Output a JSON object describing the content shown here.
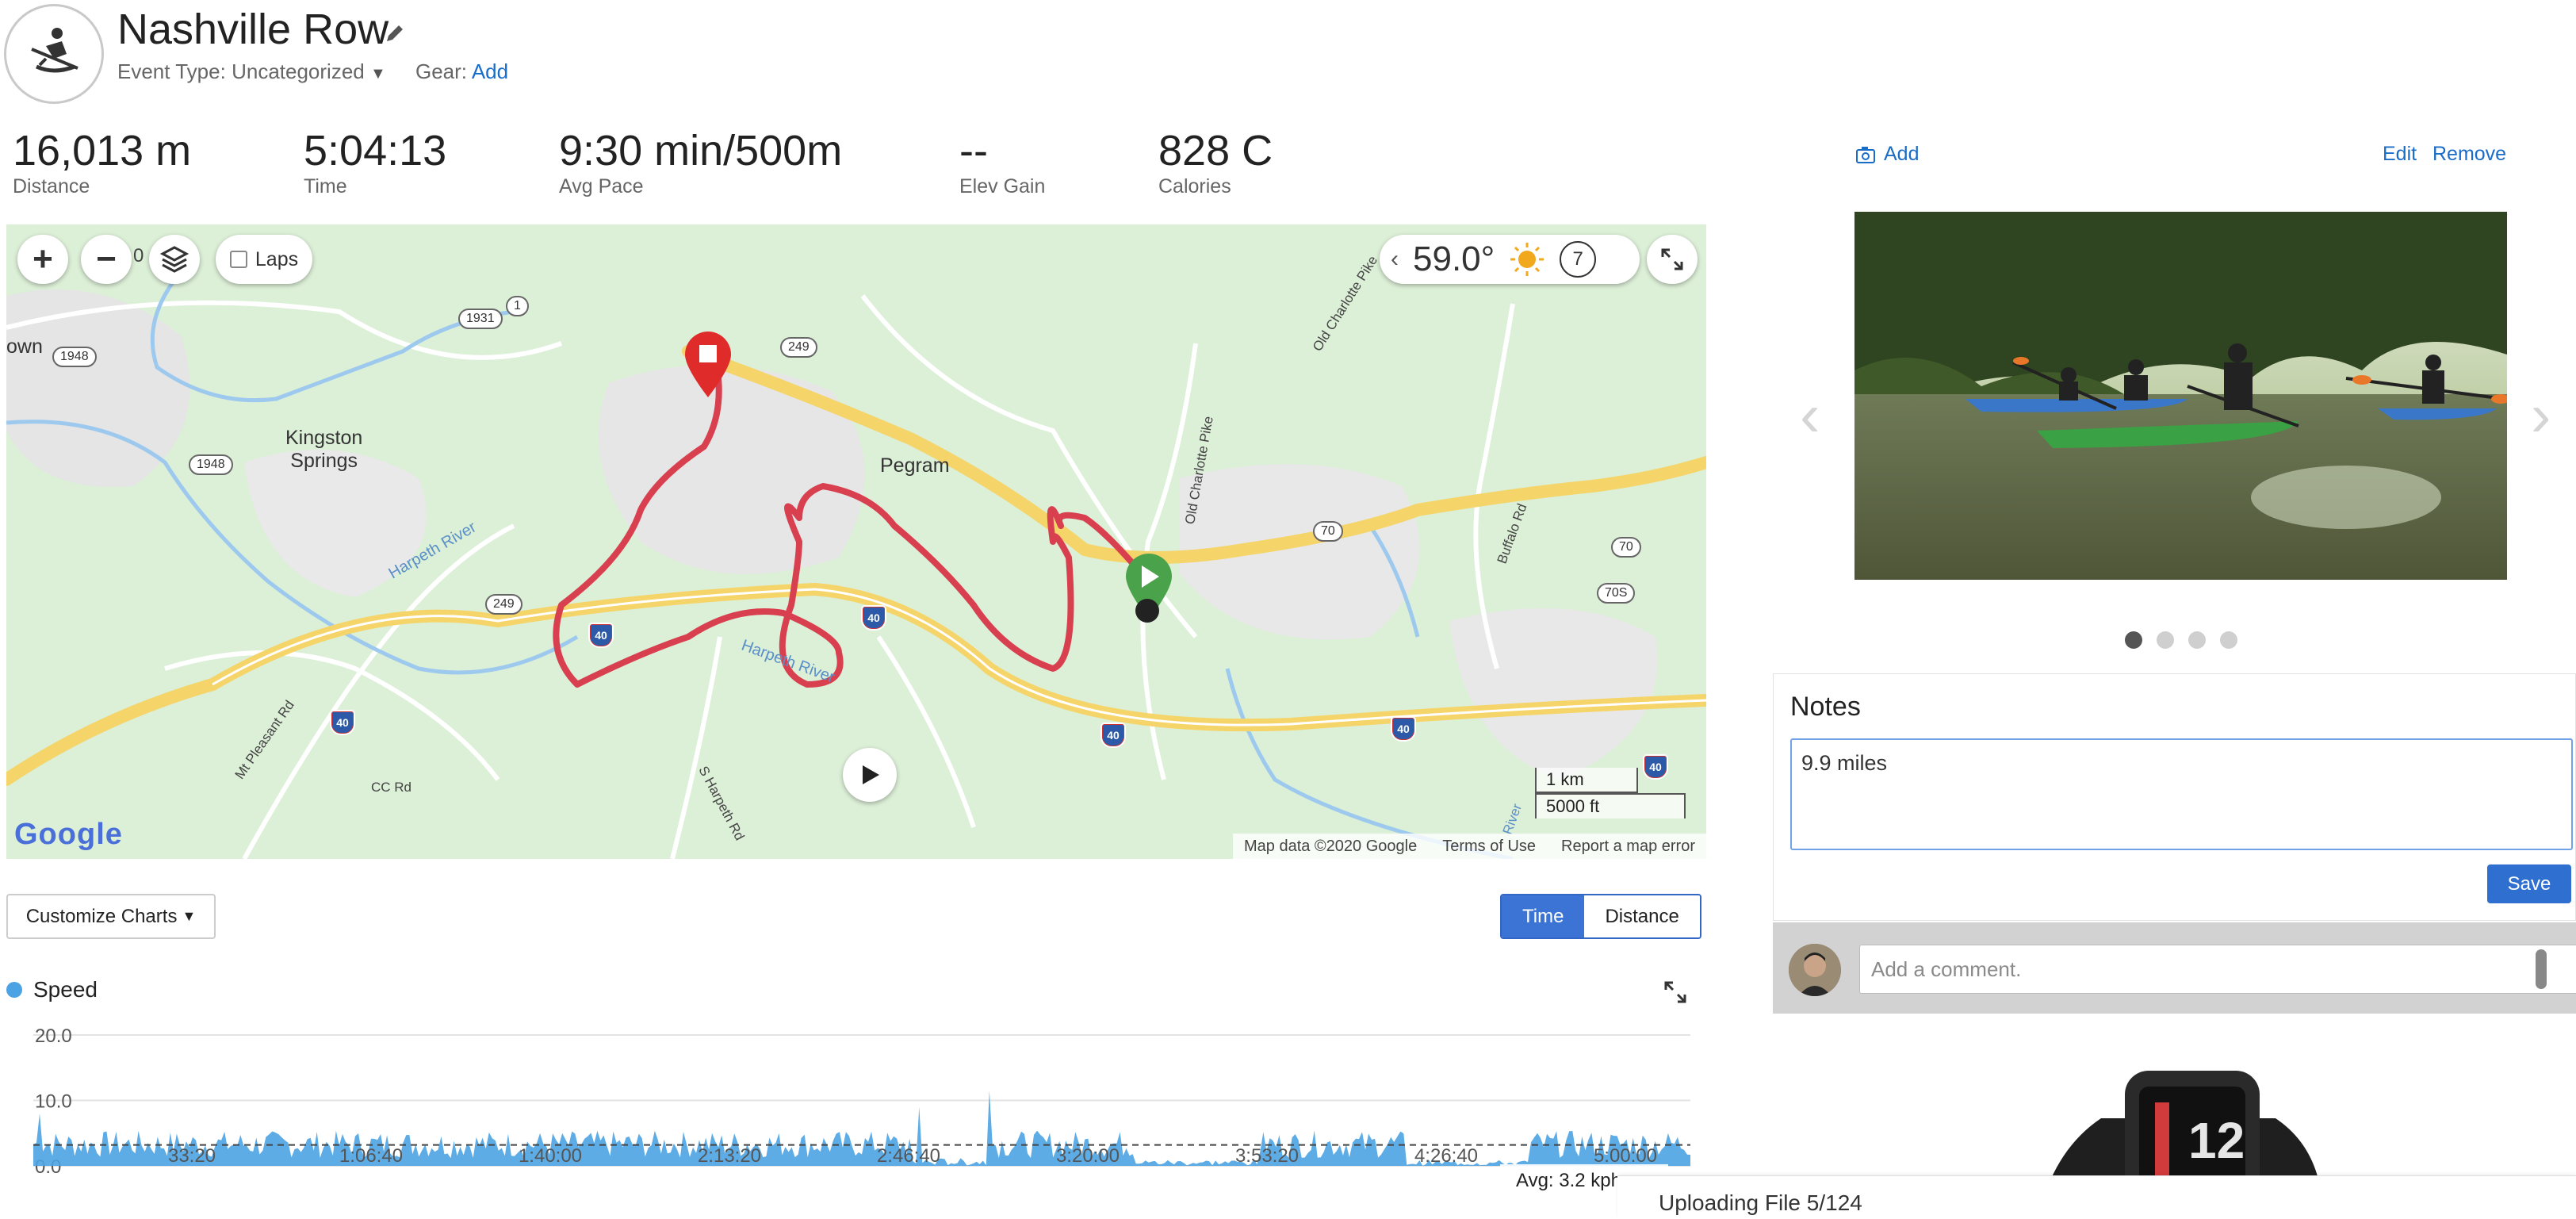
{
  "header": {
    "title": "Nashville Row",
    "event_type_label": "Event Type:",
    "event_type_value": "Uncategorized",
    "gear_label": "Gear:",
    "gear_action": "Add"
  },
  "stats": [
    {
      "value": "16,013 m",
      "label": "Distance"
    },
    {
      "value": "5:04:13",
      "label": "Time"
    },
    {
      "value": "9:30 min/500m",
      "label": "Avg Pace"
    },
    {
      "value": "--",
      "label": "Elev Gain"
    },
    {
      "value": "828 C",
      "label": "Calories"
    }
  ],
  "map": {
    "zoom_in": "+",
    "zoom_out": "−",
    "zoom_level": "0",
    "laps_label": "Laps",
    "temperature": "59.0°",
    "wind_value": "7",
    "towns": {
      "kingston": "Kingston\nSprings",
      "pegram": "Pegram",
      "own": "own"
    },
    "river_label_1": "Harpeth River",
    "river_label_2": "Harpeth River",
    "road_labels": {
      "old_charlotte_pike_1": "Old Charlotte Pike",
      "old_charlotte_pike_2": "Old Charlotte Pike",
      "buffalo_rd": "Buffalo Rd",
      "mt_pleasant": "Mt Pleasant Rd",
      "cc_rd": "CC Rd",
      "s_harpeth": "S Harpeth Rd",
      "river": "River"
    },
    "shields": {
      "r1931": "1931",
      "r1": "1",
      "r249a": "249",
      "r249b": "249",
      "r1948a": "1948",
      "r1948b": "1948",
      "r70": "70",
      "r70b": "70",
      "r70s": "70S",
      "i40": "40"
    },
    "scale_km": "1 km",
    "scale_ft": "5000 ft",
    "logo": "Google",
    "footer": [
      "Map data ©2020 Google",
      "Terms of Use",
      "Report a map error"
    ]
  },
  "chart_toolbar": {
    "customize_label": "Customize Charts",
    "time_label": "Time",
    "distance_label": "Distance"
  },
  "speed_chart": {
    "legend": "Speed",
    "avg_label": "Avg: 3.2 kph"
  },
  "chart_data": {
    "type": "area",
    "title": "",
    "series": [
      {
        "name": "Speed",
        "color": "#4ba3e3"
      }
    ],
    "y_ticks": [
      "20.0",
      "10.0",
      "0.0"
    ],
    "ylim": [
      0,
      20
    ],
    "x_ticks": [
      "33:20",
      "1:06:40",
      "1:40:00",
      "2:13:20",
      "2:46:40",
      "3:20:00",
      "3:53:20",
      "4:26:40",
      "5:00:00"
    ],
    "avg": 3.2,
    "grid": true
  },
  "photos": {
    "add_label": "Add",
    "edit_label": "Edit",
    "remove_label": "Remove",
    "count": 4,
    "active_index": 0
  },
  "notes": {
    "title": "Notes",
    "value": "9.9 miles",
    "save_label": "Save"
  },
  "comments": {
    "placeholder": "Add a comment."
  },
  "watch": {
    "display_value": "12"
  },
  "upload": {
    "status": "Uploading File 5/124"
  },
  "colors": {
    "accent": "#2f6fd0",
    "route": "#d9404f",
    "speed": "#4ba3e3",
    "map_bg": "#dcefd7"
  }
}
